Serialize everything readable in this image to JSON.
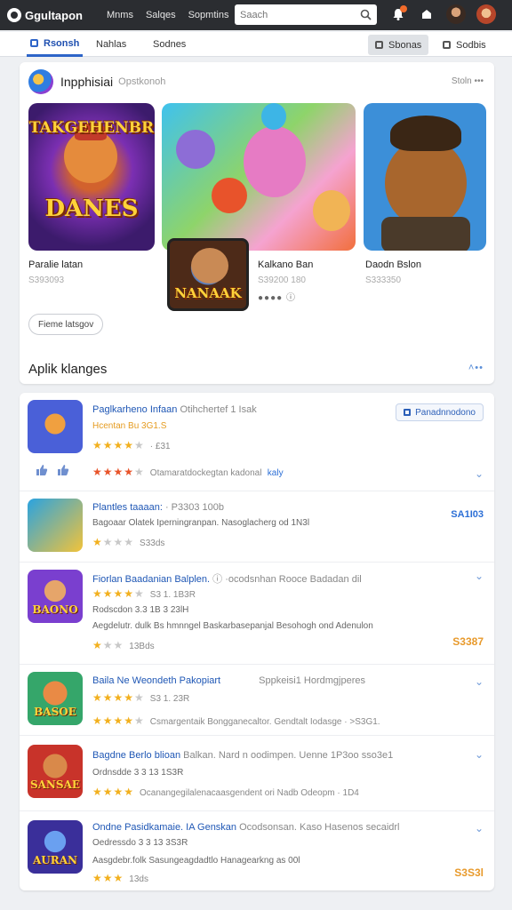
{
  "app": {
    "name": "Ggultapon"
  },
  "topnav": [
    "Mnms",
    "Salqes",
    "Sopmtins"
  ],
  "search": {
    "placeholder": "Saach"
  },
  "icons": {
    "logo": "logo-mark",
    "search": "search-icon",
    "notifications": "bell-icon",
    "alerts": "alert-icon",
    "avatar1": "avatar",
    "avatar2": "avatar"
  },
  "colors": {
    "topbar": "#2b2d31",
    "accent": "#2d64c8",
    "star": "#f2b01e",
    "price": "#e89a2c"
  },
  "tabs": [
    {
      "label": "Rsonsh",
      "active": true
    },
    {
      "label": "Nahlas",
      "active": false
    },
    {
      "label": "Sodnes",
      "active": false
    }
  ],
  "tab_buttons": [
    "Sbonas",
    "Sodbis"
  ],
  "featured": {
    "title": "Inpphisiai",
    "subtitle": "Opstkonoh",
    "more": "Stoln •••",
    "games": [
      {
        "art_title": "TAKGEHENBR",
        "art_sub": "DANES",
        "name": "Paralie latan",
        "sub": "S393093"
      },
      {
        "art_title": "",
        "name": "Kalkano Ban",
        "sub": "S39200 180",
        "dots": "●●●●  ⓘ"
      },
      {
        "art_title": "",
        "name": "Daodn Bslon",
        "sub": "S333350"
      },
      {
        "art_title": "NANAAK"
      }
    ],
    "button": "Fieme latsgov",
    "section_title": "Aplik klanges",
    "section_more": "˄••"
  },
  "list": [
    {
      "icon_label": "",
      "title": "Paglkarheno Infaan",
      "title_muted": "Otihchertef 1 Isak",
      "line1": "Hcentan Bu 3G1.S",
      "line1_style": "orange",
      "stars": "★★★★",
      "stars_empty": "★",
      "stars_meta": "· £31",
      "stars2": "★★★★",
      "stars2_empty": "★",
      "stars2_meta": "Otamaratdockegtan kadonal",
      "stars2_link": "kaly",
      "tag": "Panadnnodono"
    },
    {
      "icon_label": "",
      "title": "Plantles taaaan:",
      "title_muted": "· P3303 100b",
      "line1": "Bagoaar Olatek Iperningranpan. Nasoglacherg od 1N3l",
      "stars": "★",
      "stars_empty": "★★★",
      "stars_meta": "S33ds",
      "price": "SA1I03"
    },
    {
      "icon_label": "BAONO",
      "title": "Fiorlan Baadanian Balplen.",
      "title_muted": "ⓘ  ·ocodsnhan Rooce Badadan dil",
      "stars": "★★★★",
      "stars_empty": "★",
      "stars_meta": "S3 1. 1B3R",
      "line1": "Rodscdon 3.3  1B 3  23lH",
      "line2": "Aegdelutr. dulk Bs hmnngel Baskarbasepanjal Besohogh ond Adenulon",
      "rating_meta": "13Bds",
      "price": "S3387"
    },
    {
      "icon_label": "BASOE",
      "title": "Baila Ne Weondeth Pakopiart",
      "title_muted": "Sppkeisi1 Hordmgjperes",
      "stars": "★★★★",
      "stars_empty": "★",
      "stars_meta": "S3 1. 23R",
      "line2": "Csmargentaik Bongganecaltor. Gendtalt Iodasge · >S3G1.",
      "price": ""
    },
    {
      "icon_label": "SANSAE",
      "title": "Bagdne Berlo blioan",
      "title_muted": "Balkan. Nard n oodimpen. Uenne 1P3oo sso3e1",
      "line1": "Ordnsdde 3 3  13  1S3R",
      "stars": "★★★★",
      "stars_empty": "",
      "stars_meta": "Ocanangegilalenacaasgendent ori Nadb Odeopm · 1D4",
      "price": ""
    },
    {
      "icon_label": "AURAN",
      "title": "Ondne Pasidkamaie. IA  Genskan",
      "title_muted": "Ocodsonsan. Kaso Hasenos secaidrl",
      "line1": "Oedressdo 3 3  13 3S3R",
      "line2": "Aasgdebr.folk  Sasungeagdadtlo Hanagearkng as 00l",
      "stars": "★★★",
      "stars_empty": "",
      "stars_meta": "13ds",
      "price": "S3S3l"
    }
  ]
}
